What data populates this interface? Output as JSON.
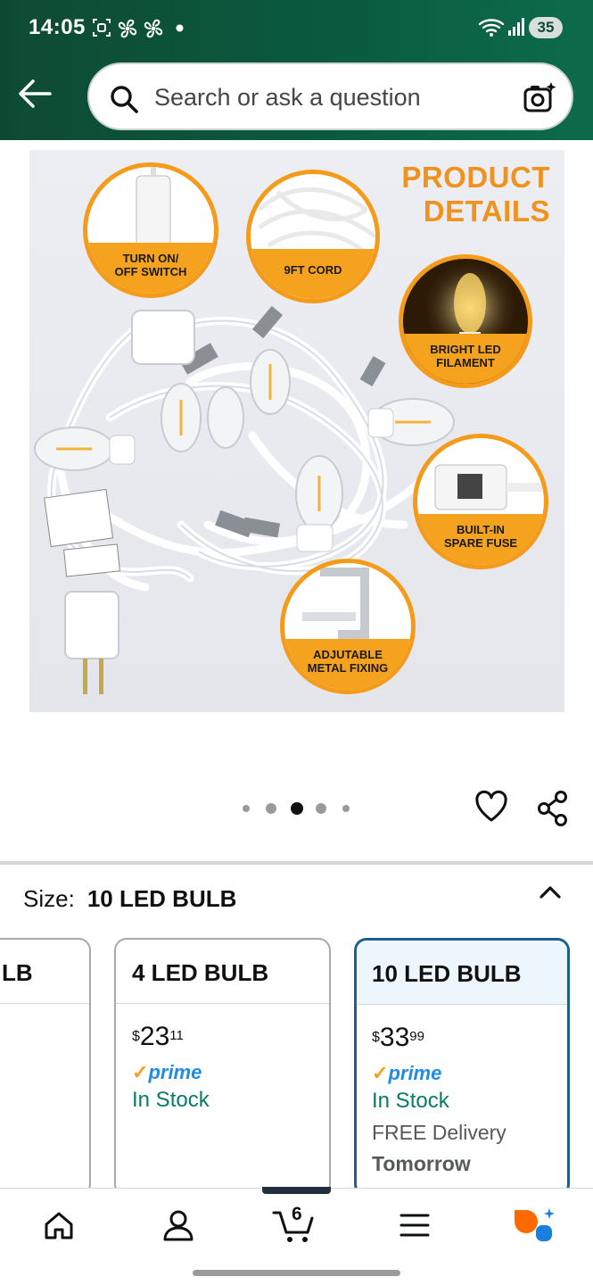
{
  "status_bar": {
    "time": "14:05",
    "battery": "35"
  },
  "search": {
    "placeholder": "Search or ask a question"
  },
  "product_image": {
    "headline": "PRODUCT\nDETAILS",
    "callouts": [
      "TURN ON/\nOFF SWITCH",
      "9FT CORD",
      "BRIGHT LED\nFILAMENT",
      "BUILT-IN\nSPARE FUSE",
      "ADJUTABLE\nMETAL FIXING"
    ]
  },
  "carousel": {
    "total": 5,
    "active_index": 2
  },
  "size": {
    "label": "Size:",
    "selected": "10 LED BULB"
  },
  "options": [
    {
      "title": "LB",
      "partial": true
    },
    {
      "title": "4 LED BULB",
      "price_whole": "23",
      "price_frac": "11",
      "currency": "$",
      "prime": "prime",
      "stock": "In Stock"
    },
    {
      "title": "10 LED BULB",
      "price_whole": "33",
      "price_frac": "99",
      "currency": "$",
      "prime": "prime",
      "stock": "In Stock",
      "delivery": "FREE Delivery",
      "delivery_day": "Tomorrow",
      "selected": true
    }
  ],
  "bottom_nav": {
    "cart_count": "6",
    "items": [
      "home-icon",
      "account-icon",
      "cart-icon",
      "menu-icon",
      "rufus-icon"
    ]
  },
  "colors": {
    "header_bg": "#0e4a33",
    "prime_blue": "#1f8ce6",
    "in_stock_green": "#067d62",
    "selected_border": "#1f5f8b",
    "accent_orange": "#f59b1c"
  }
}
